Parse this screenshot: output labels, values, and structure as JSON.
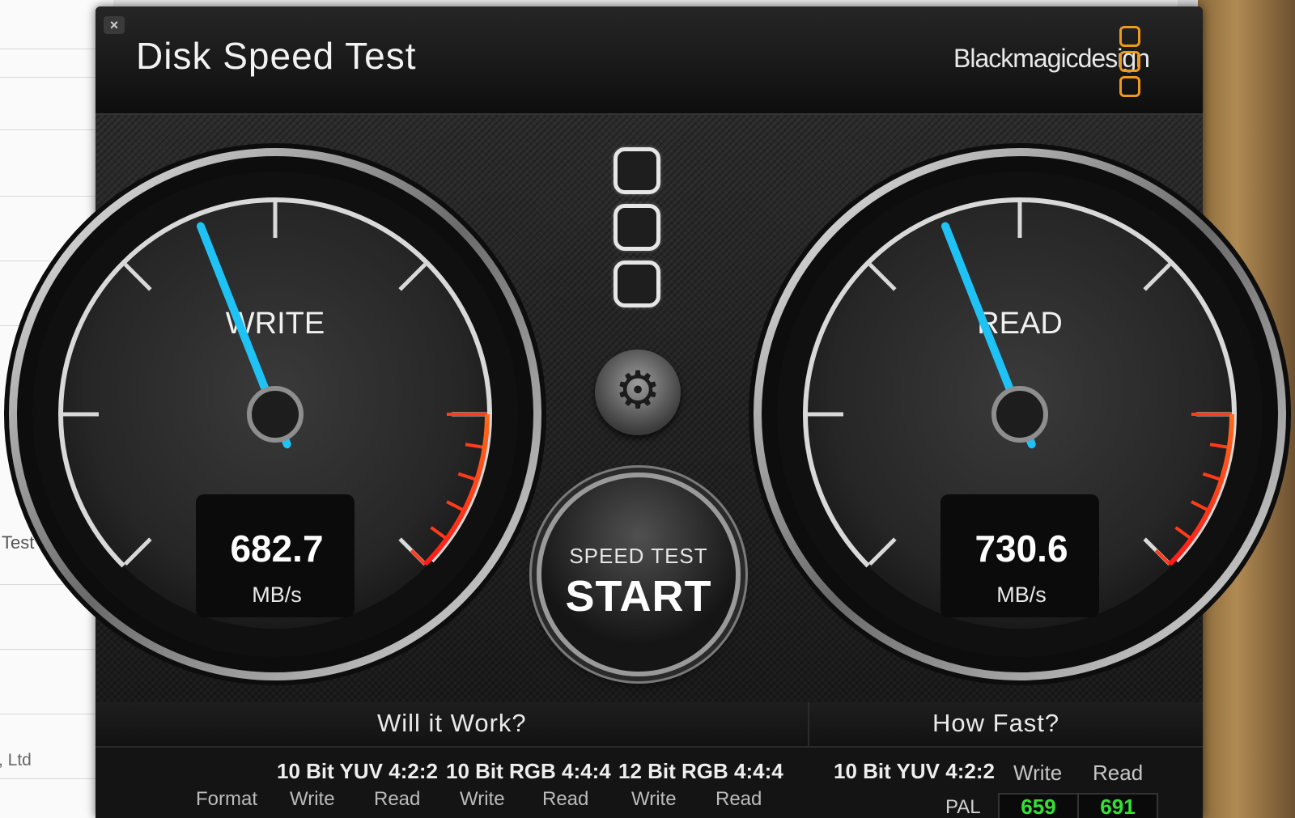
{
  "background_window": {
    "fragment_text_1": "Test",
    "fragment_text_2": ", Ltd"
  },
  "window": {
    "close_label": "×",
    "title": "Disk Speed Test",
    "brand": "Blackmagicdesign"
  },
  "gauges": {
    "write": {
      "label": "WRITE",
      "value": "682.7",
      "unit": "MB/s",
      "needle_fraction": 0.42
    },
    "read": {
      "label": "READ",
      "value": "730.6",
      "unit": "MB/s",
      "needle_fraction": 0.42
    }
  },
  "start_button": {
    "line1": "SPEED TEST",
    "line2": "START"
  },
  "will_it_work": {
    "title": "Will it Work?",
    "format_label": "Format",
    "columns": [
      {
        "name": "10 Bit YUV 4:2:2",
        "write": "Write",
        "read": "Read"
      },
      {
        "name": "10 Bit RGB 4:4:4",
        "write": "Write",
        "read": "Read"
      },
      {
        "name": "12 Bit RGB 4:4:4",
        "write": "Write",
        "read": "Read"
      }
    ]
  },
  "how_fast": {
    "title": "How Fast?",
    "format": "10 Bit YUV 4:2:2",
    "write_label": "Write",
    "read_label": "Read",
    "row_label": "PAL",
    "write_value": "659",
    "read_value": "691"
  },
  "colors": {
    "needle": "#1ec2f5",
    "redline": "#ff3b1a",
    "accent_logo": "#f09a1a",
    "fps_value": "#35e135"
  }
}
